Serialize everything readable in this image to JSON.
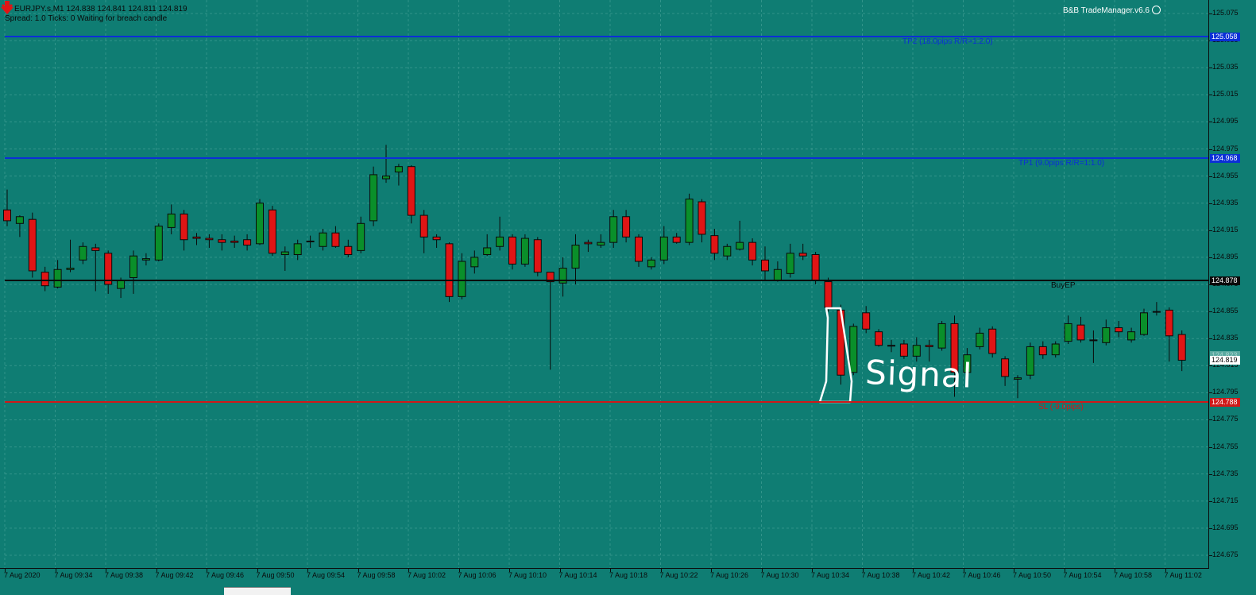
{
  "header": {
    "symbol_line": "EURJPY.s,M1  124.838 124.841 124.811 124.819",
    "status_line": "Spread: 1.0  Ticks: 0  Waiting for breach candle"
  },
  "expert": {
    "name": "B&B TradeManager.v6.6",
    "icon": "smiley-icon"
  },
  "price_axis": {
    "min": 124.665,
    "max": 125.085,
    "ticks": [
      "125.075",
      "125.055",
      "125.035",
      "125.015",
      "124.995",
      "124.975",
      "124.955",
      "124.935",
      "124.915",
      "124.895",
      "124.875",
      "124.855",
      "124.835",
      "124.815",
      "124.795",
      "124.775",
      "124.755",
      "124.735",
      "124.715",
      "124.695",
      "124.675"
    ],
    "current_price": "124.819",
    "faint_tag": "124.823"
  },
  "levels": [
    {
      "key": "tp2",
      "price": 125.058,
      "tag": "125.058",
      "label": "TP2 (18.0pips R/R=1:2.0)",
      "color": "#0b2fd6"
    },
    {
      "key": "tp1",
      "price": 124.968,
      "tag": "124.968",
      "label": "TP1 (9.0pips R/R=1:1.0)",
      "color": "#0b2fd6"
    },
    {
      "key": "entry",
      "price": 124.878,
      "tag": "124.878",
      "label": "BuyEP",
      "color": "#0a0a0a"
    },
    {
      "key": "sl",
      "price": 124.788,
      "tag": "124.788",
      "label": "SL (-9.0pips)",
      "color": "#d01818"
    }
  ],
  "time_axis": {
    "labels": [
      "7 Aug 2020",
      "7 Aug 09:34",
      "7 Aug 09:38",
      "7 Aug 09:42",
      "7 Aug 09:46",
      "7 Aug 09:50",
      "7 Aug 09:54",
      "7 Aug 09:58",
      "7 Aug 10:02",
      "7 Aug 10:06",
      "7 Aug 10:10",
      "7 Aug 10:14",
      "7 Aug 10:18",
      "7 Aug 10:22",
      "7 Aug 10:26",
      "7 Aug 10:30",
      "7 Aug 10:34",
      "7 Aug 10:38",
      "7 Aug 10:42",
      "7 Aug 10:46",
      "7 Aug 10:50",
      "7 Aug 10:54",
      "7 Aug 10:58",
      "7 Aug 11:02"
    ]
  },
  "annotation": {
    "text": "Signal"
  },
  "colors": {
    "background": "#0f7d73",
    "bull": "#0a8f2a",
    "bear": "#e01515",
    "wick": "#0a0a0a",
    "grid": "#4fa79d"
  },
  "chart_data": {
    "type": "candlestick",
    "symbol": "EURJPY.s",
    "timeframe": "M1",
    "ylim": [
      124.665,
      125.085
    ],
    "candles": [
      {
        "o": 124.93,
        "h": 124.945,
        "l": 124.918,
        "c": 124.922
      },
      {
        "o": 124.92,
        "h": 124.926,
        "l": 124.91,
        "c": 124.925
      },
      {
        "o": 124.923,
        "h": 124.928,
        "l": 124.88,
        "c": 124.885
      },
      {
        "o": 124.884,
        "h": 124.888,
        "l": 124.87,
        "c": 124.874
      },
      {
        "o": 124.873,
        "h": 124.893,
        "l": 124.872,
        "c": 124.886
      },
      {
        "o": 124.886,
        "h": 124.908,
        "l": 124.884,
        "c": 124.887
      },
      {
        "o": 124.893,
        "h": 124.906,
        "l": 124.89,
        "c": 124.903
      },
      {
        "o": 124.902,
        "h": 124.905,
        "l": 124.87,
        "c": 124.9
      },
      {
        "o": 124.898,
        "h": 124.9,
        "l": 124.868,
        "c": 124.875
      },
      {
        "o": 124.872,
        "h": 124.88,
        "l": 124.865,
        "c": 124.878
      },
      {
        "o": 124.88,
        "h": 124.9,
        "l": 124.868,
        "c": 124.896
      },
      {
        "o": 124.893,
        "h": 124.898,
        "l": 124.889,
        "c": 124.894
      },
      {
        "o": 124.893,
        "h": 124.92,
        "l": 124.892,
        "c": 124.918
      },
      {
        "o": 124.917,
        "h": 124.934,
        "l": 124.912,
        "c": 124.927
      },
      {
        "o": 124.927,
        "h": 124.93,
        "l": 124.9,
        "c": 124.908
      },
      {
        "o": 124.91,
        "h": 124.913,
        "l": 124.904,
        "c": 124.909
      },
      {
        "o": 124.909,
        "h": 124.912,
        "l": 124.902,
        "c": 124.908
      },
      {
        "o": 124.908,
        "h": 124.912,
        "l": 124.9,
        "c": 124.906
      },
      {
        "o": 124.907,
        "h": 124.911,
        "l": 124.902,
        "c": 124.906
      },
      {
        "o": 124.908,
        "h": 124.912,
        "l": 124.9,
        "c": 124.904
      },
      {
        "o": 124.905,
        "h": 124.938,
        "l": 124.904,
        "c": 124.935
      },
      {
        "o": 124.93,
        "h": 124.933,
        "l": 124.896,
        "c": 124.898
      },
      {
        "o": 124.897,
        "h": 124.903,
        "l": 124.885,
        "c": 124.899
      },
      {
        "o": 124.897,
        "h": 124.908,
        "l": 124.893,
        "c": 124.905
      },
      {
        "o": 124.907,
        "h": 124.911,
        "l": 124.902,
        "c": 124.907
      },
      {
        "o": 124.903,
        "h": 124.916,
        "l": 124.9,
        "c": 124.913
      },
      {
        "o": 124.913,
        "h": 124.918,
        "l": 124.902,
        "c": 124.903
      },
      {
        "o": 124.903,
        "h": 124.908,
        "l": 124.895,
        "c": 124.897
      },
      {
        "o": 124.9,
        "h": 124.925,
        "l": 124.898,
        "c": 124.92
      },
      {
        "o": 124.922,
        "h": 124.962,
        "l": 124.918,
        "c": 124.956
      },
      {
        "o": 124.953,
        "h": 124.978,
        "l": 124.95,
        "c": 124.955
      },
      {
        "o": 124.958,
        "h": 124.964,
        "l": 124.948,
        "c": 124.962
      },
      {
        "o": 124.962,
        "h": 124.963,
        "l": 124.92,
        "c": 124.926
      },
      {
        "o": 124.926,
        "h": 124.93,
        "l": 124.898,
        "c": 124.91
      },
      {
        "o": 124.91,
        "h": 124.912,
        "l": 124.902,
        "c": 124.908
      },
      {
        "o": 124.905,
        "h": 124.906,
        "l": 124.862,
        "c": 124.866
      },
      {
        "o": 124.866,
        "h": 124.898,
        "l": 124.864,
        "c": 124.892
      },
      {
        "o": 124.888,
        "h": 124.9,
        "l": 124.883,
        "c": 124.895
      },
      {
        "o": 124.897,
        "h": 124.912,
        "l": 124.896,
        "c": 124.902
      },
      {
        "o": 124.903,
        "h": 124.925,
        "l": 124.9,
        "c": 124.91
      },
      {
        "o": 124.91,
        "h": 124.912,
        "l": 124.886,
        "c": 124.89
      },
      {
        "o": 124.89,
        "h": 124.912,
        "l": 124.888,
        "c": 124.909
      },
      {
        "o": 124.908,
        "h": 124.91,
        "l": 124.881,
        "c": 124.884
      },
      {
        "o": 124.884,
        "h": 124.884,
        "l": 124.812,
        "c": 124.877
      },
      {
        "o": 124.876,
        "h": 124.895,
        "l": 124.866,
        "c": 124.887
      },
      {
        "o": 124.887,
        "h": 124.912,
        "l": 124.875,
        "c": 124.904
      },
      {
        "o": 124.906,
        "h": 124.908,
        "l": 124.899,
        "c": 124.905
      },
      {
        "o": 124.904,
        "h": 124.912,
        "l": 124.902,
        "c": 124.906
      },
      {
        "o": 124.906,
        "h": 124.93,
        "l": 124.902,
        "c": 124.925
      },
      {
        "o": 124.925,
        "h": 124.93,
        "l": 124.906,
        "c": 124.91
      },
      {
        "o": 124.91,
        "h": 124.912,
        "l": 124.888,
        "c": 124.892
      },
      {
        "o": 124.888,
        "h": 124.895,
        "l": 124.886,
        "c": 124.893
      },
      {
        "o": 124.893,
        "h": 124.918,
        "l": 124.89,
        "c": 124.91
      },
      {
        "o": 124.91,
        "h": 124.913,
        "l": 124.905,
        "c": 124.906
      },
      {
        "o": 124.906,
        "h": 124.942,
        "l": 124.904,
        "c": 124.938
      },
      {
        "o": 124.936,
        "h": 124.938,
        "l": 124.906,
        "c": 124.912
      },
      {
        "o": 124.911,
        "h": 124.916,
        "l": 124.893,
        "c": 124.898
      },
      {
        "o": 124.896,
        "h": 124.905,
        "l": 124.893,
        "c": 124.903
      },
      {
        "o": 124.901,
        "h": 124.922,
        "l": 124.9,
        "c": 124.906
      },
      {
        "o": 124.906,
        "h": 124.909,
        "l": 124.889,
        "c": 124.893
      },
      {
        "o": 124.893,
        "h": 124.903,
        "l": 124.878,
        "c": 124.885
      },
      {
        "o": 124.878,
        "h": 124.892,
        "l": 124.877,
        "c": 124.886
      },
      {
        "o": 124.883,
        "h": 124.905,
        "l": 124.88,
        "c": 124.898
      },
      {
        "o": 124.898,
        "h": 124.905,
        "l": 124.893,
        "c": 124.896
      },
      {
        "o": 124.897,
        "h": 124.899,
        "l": 124.875,
        "c": 124.878
      },
      {
        "o": 124.877,
        "h": 124.88,
        "l": 124.855,
        "c": 124.858
      },
      {
        "o": 124.856,
        "h": 124.86,
        "l": 124.801,
        "c": 124.808
      },
      {
        "o": 124.81,
        "h": 124.846,
        "l": 124.808,
        "c": 124.844
      },
      {
        "o": 124.854,
        "h": 124.859,
        "l": 124.839,
        "c": 124.842
      },
      {
        "o": 124.84,
        "h": 124.842,
        "l": 124.829,
        "c": 124.83
      },
      {
        "o": 124.83,
        "h": 124.834,
        "l": 124.825,
        "c": 124.83
      },
      {
        "o": 124.831,
        "h": 124.834,
        "l": 124.82,
        "c": 124.822
      },
      {
        "o": 124.822,
        "h": 124.836,
        "l": 124.818,
        "c": 124.83
      },
      {
        "o": 124.83,
        "h": 124.834,
        "l": 124.818,
        "c": 124.829
      },
      {
        "o": 124.828,
        "h": 124.848,
        "l": 124.826,
        "c": 124.846
      },
      {
        "o": 124.846,
        "h": 124.852,
        "l": 124.792,
        "c": 124.81
      },
      {
        "o": 124.81,
        "h": 124.828,
        "l": 124.808,
        "c": 124.823
      },
      {
        "o": 124.829,
        "h": 124.843,
        "l": 124.827,
        "c": 124.839
      },
      {
        "o": 124.842,
        "h": 124.844,
        "l": 124.821,
        "c": 124.824
      },
      {
        "o": 124.82,
        "h": 124.822,
        "l": 124.8,
        "c": 124.807
      },
      {
        "o": 124.805,
        "h": 124.808,
        "l": 124.791,
        "c": 124.806
      },
      {
        "o": 124.808,
        "h": 124.832,
        "l": 124.805,
        "c": 124.829
      },
      {
        "o": 124.829,
        "h": 124.833,
        "l": 124.82,
        "c": 124.823
      },
      {
        "o": 124.823,
        "h": 124.833,
        "l": 124.821,
        "c": 124.831
      },
      {
        "o": 124.833,
        "h": 124.852,
        "l": 124.831,
        "c": 124.846
      },
      {
        "o": 124.845,
        "h": 124.851,
        "l": 124.832,
        "c": 124.834
      },
      {
        "o": 124.834,
        "h": 124.841,
        "l": 124.817,
        "c": 124.834
      },
      {
        "o": 124.832,
        "h": 124.849,
        "l": 124.83,
        "c": 124.843
      },
      {
        "o": 124.843,
        "h": 124.848,
        "l": 124.836,
        "c": 124.84
      },
      {
        "o": 124.834,
        "h": 124.843,
        "l": 124.832,
        "c": 124.84
      },
      {
        "o": 124.838,
        "h": 124.857,
        "l": 124.837,
        "c": 124.854
      },
      {
        "o": 124.855,
        "h": 124.862,
        "l": 124.852,
        "c": 124.855
      },
      {
        "o": 124.856,
        "h": 124.858,
        "l": 124.818,
        "c": 124.837
      },
      {
        "o": 124.838,
        "h": 124.841,
        "l": 124.811,
        "c": 124.819
      }
    ]
  }
}
